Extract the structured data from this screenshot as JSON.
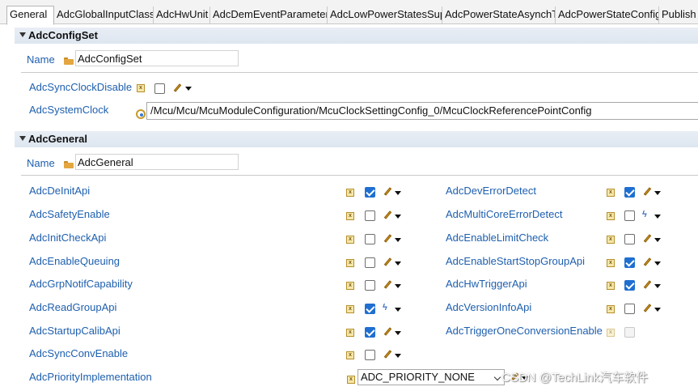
{
  "tabs": [
    {
      "label": "General",
      "active": true
    },
    {
      "label": "AdcGlobalInputClass"
    },
    {
      "label": "AdcHwUnit"
    },
    {
      "label": "AdcDemEventParameter"
    },
    {
      "label": "AdcLowPowerStatesSup"
    },
    {
      "label": "AdcPowerStateAsynchT"
    },
    {
      "label": "AdcPowerStateConfig"
    },
    {
      "label": "Publish"
    }
  ],
  "config_set": {
    "title": "AdcConfigSet",
    "name_label": "Name",
    "name_value": "AdcConfigSet",
    "sync_clock_disable_label": "AdcSyncClockDisable",
    "sync_clock_disable_checked": false,
    "system_clock_label": "AdcSystemClock",
    "system_clock_value": "/Mcu/Mcu/McuModuleConfiguration/McuClockSettingConfig_0/McuClockReferencePointConfig"
  },
  "general": {
    "title": "AdcGeneral",
    "name_label": "Name",
    "name_value": "AdcGeneral",
    "left_params": [
      {
        "label": "AdcDeInitApi",
        "checked": true,
        "editor": "pencil"
      },
      {
        "label": "AdcSafetyEnable",
        "checked": false,
        "editor": "pencil"
      },
      {
        "label": "AdcInitCheckApi",
        "checked": false,
        "editor": "pencil"
      },
      {
        "label": "AdcEnableQueuing",
        "checked": false,
        "editor": "pencil"
      },
      {
        "label": "AdcGrpNotifCapability",
        "checked": false,
        "editor": "pencil"
      },
      {
        "label": "AdcReadGroupApi",
        "checked": true,
        "editor": "calc"
      },
      {
        "label": "AdcStartupCalibApi",
        "checked": true,
        "editor": "pencil"
      },
      {
        "label": "AdcSyncConvEnable",
        "checked": false,
        "editor": "pencil"
      }
    ],
    "right_params": [
      {
        "label": "AdcDevErrorDetect",
        "checked": true,
        "editor": "pencil"
      },
      {
        "label": "AdcMultiCoreErrorDetect",
        "checked": false,
        "editor": "calc"
      },
      {
        "label": "AdcEnableLimitCheck",
        "checked": false,
        "editor": "pencil"
      },
      {
        "label": "AdcEnableStartStopGroupApi",
        "checked": true,
        "editor": "pencil"
      },
      {
        "label": "AdcHwTriggerApi",
        "checked": true,
        "editor": "pencil"
      },
      {
        "label": "AdcVersionInfoApi",
        "checked": false,
        "editor": "pencil"
      },
      {
        "label": "AdcTriggerOneConversionEnable",
        "checked": false,
        "editor": "none",
        "disabled": true
      }
    ],
    "priority_label": "AdcPriorityImplementation",
    "priority_value": "ADC_PRIORITY_NONE"
  },
  "watermark": "CSDN @TechLink汽车软件"
}
